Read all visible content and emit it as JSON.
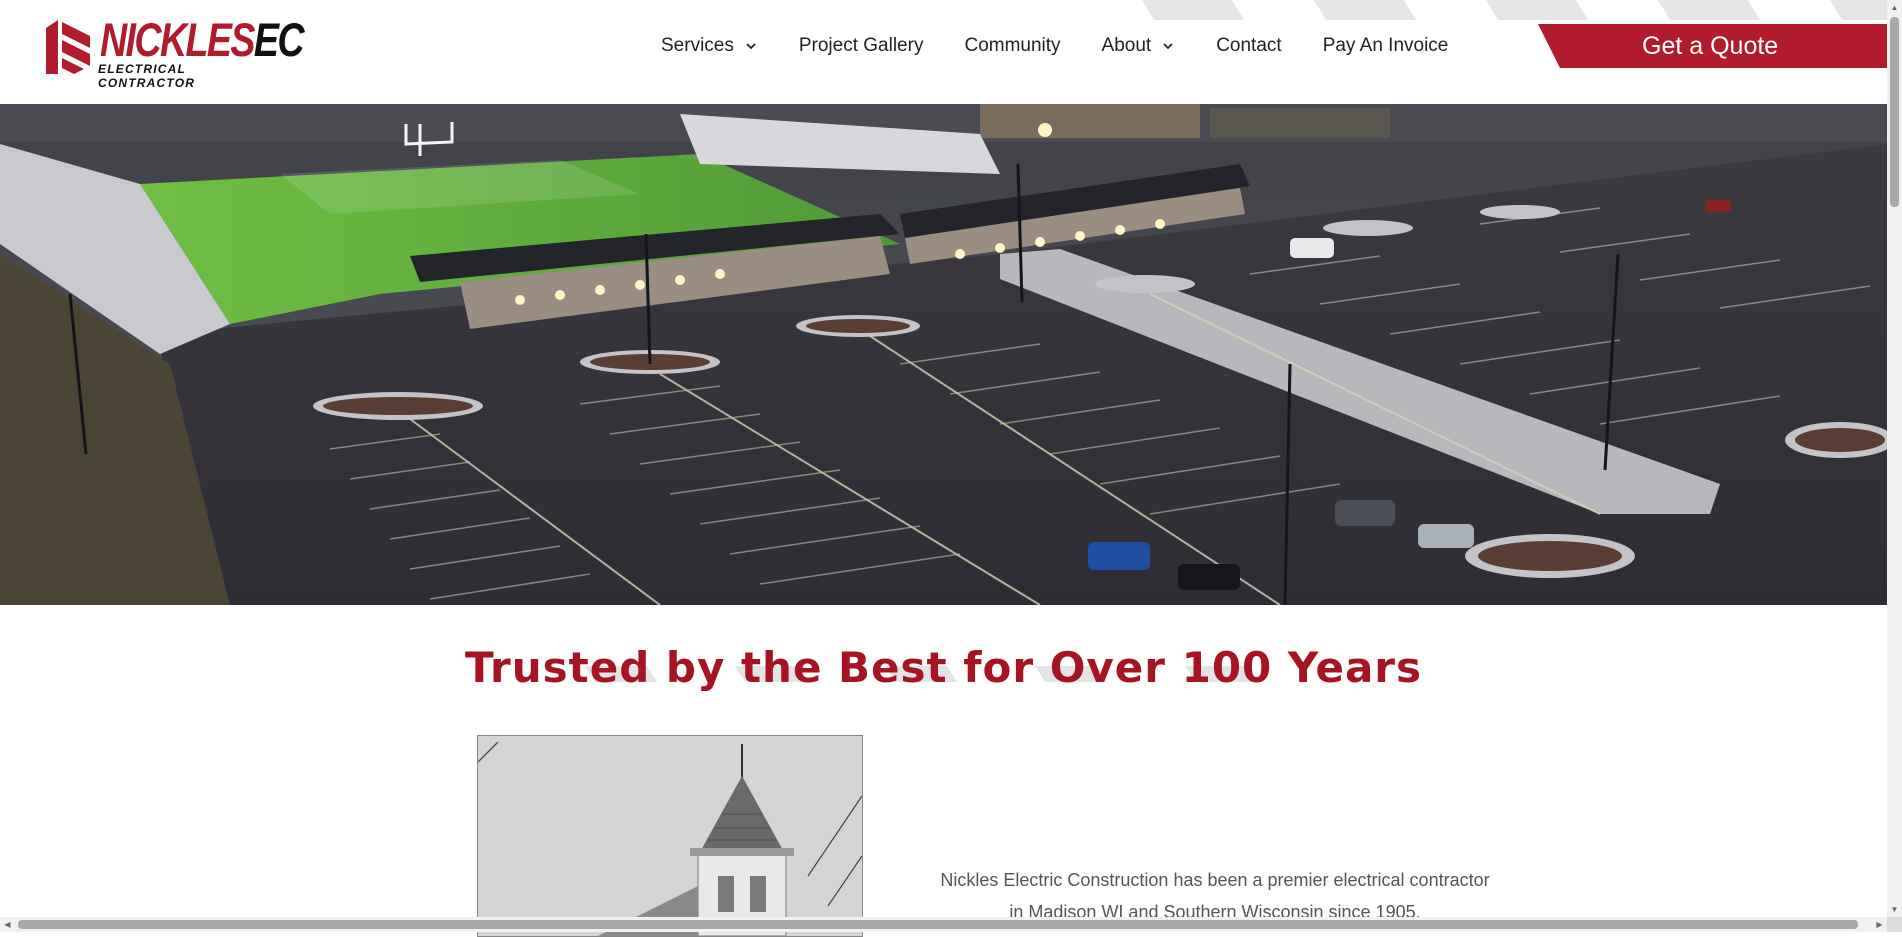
{
  "brand": {
    "name_red": "NICKLES",
    "name_black": "EC",
    "tagline": "ELECTRICAL CONTRACTOR",
    "color": "#b01c2e"
  },
  "nav": {
    "items": [
      {
        "label": "Services",
        "has_dropdown": true
      },
      {
        "label": "Project Gallery",
        "has_dropdown": false
      },
      {
        "label": "Community",
        "has_dropdown": false
      },
      {
        "label": "About",
        "has_dropdown": true
      },
      {
        "label": "Contact",
        "has_dropdown": false
      },
      {
        "label": "Pay An Invoice",
        "has_dropdown": false
      }
    ]
  },
  "cta": {
    "label": "Get a Quote"
  },
  "hero": {
    "image": "aerial-stadium-parking-lot-night"
  },
  "section": {
    "heading": "Trusted by the Best for Over 100 Years",
    "text": "Nickles Electric Construction has been a premier electrical contractor in Madison WI and Southern Wisconsin since 1905.",
    "photo": "historic-church-steeple-photo"
  },
  "colors": {
    "accent": "#b01c2e",
    "heading": "#a61424",
    "text": "#555555"
  },
  "icons": {
    "dropdown": "chevron-down-icon",
    "scroll_up": "arrow-up-icon",
    "scroll_down": "arrow-down-icon",
    "scroll_left": "arrow-left-icon",
    "scroll_right": "arrow-right-icon"
  }
}
